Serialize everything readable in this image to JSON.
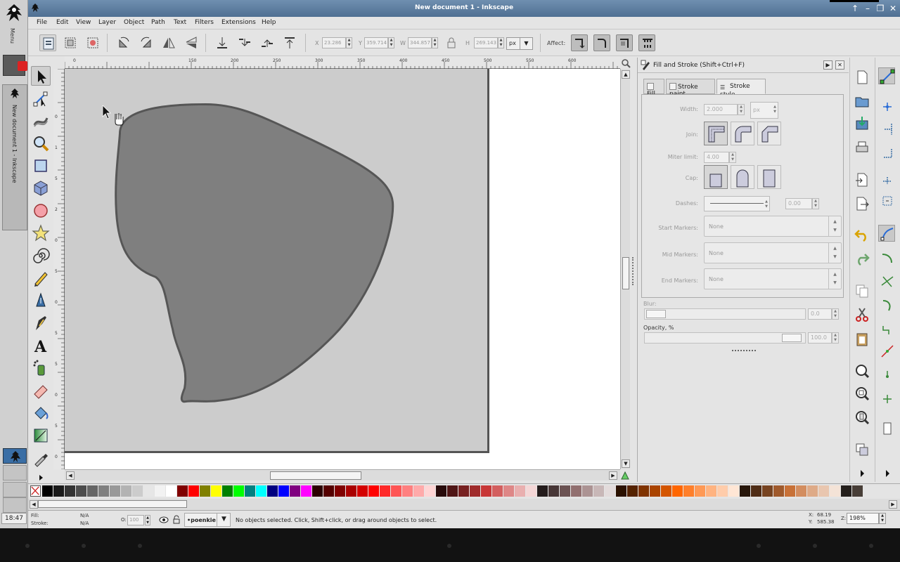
{
  "window": {
    "title": "New document 1 - Inkscape",
    "buttons": [
      "↑",
      "–",
      "❐",
      "✕"
    ]
  },
  "launcher": {
    "menu_label": "Menu",
    "doc_label": "New document 1 - Inkscape",
    "clock": "18:47"
  },
  "menubar": {
    "items": [
      "File",
      "Edit",
      "View",
      "Layer",
      "Object",
      "Path",
      "Text",
      "Filters",
      "Extensions",
      "Help"
    ]
  },
  "toolctrl": {
    "x_label": "X",
    "x_value": "23.286",
    "y_label": "Y",
    "y_value": "359.714",
    "w_label": "W",
    "w_value": "344.857",
    "h_label": "H",
    "h_value": "269.143",
    "unit": "px",
    "affect_label": "Affect:"
  },
  "rulers": {
    "top": [
      "0",
      "150",
      "200",
      "250",
      "300",
      "350",
      "400",
      "450",
      "500",
      "550",
      "600"
    ],
    "left": [
      "0",
      "1",
      "5",
      "2",
      "0",
      "5",
      "0",
      "5",
      "5",
      "0",
      "5",
      "0"
    ]
  },
  "dock": {
    "title": "Fill and Stroke (Shift+Ctrl+F)",
    "tabs": [
      "Fill",
      "Stroke paint",
      "Stroke style"
    ],
    "width_label": "Width:",
    "width_value": "2.000",
    "width_unit": "px",
    "join_label": "Join:",
    "miter_label": "Miter limit:",
    "miter_value": "4.00",
    "cap_label": "Cap:",
    "dashes_label": "Dashes:",
    "dashes_value": "0.00",
    "start_markers_label": "Start Markers:",
    "start_markers_value": "None",
    "mid_markers_label": "Mid Markers:",
    "mid_markers_value": "None",
    "end_markers_label": "End Markers:",
    "end_markers_value": "None",
    "blur_label": "Blur:",
    "blur_value": "0.0",
    "opacity_label": "Opacity, %",
    "opacity_value": "100.0"
  },
  "statusbar": {
    "fill_label": "Fill:",
    "fill_value": "N/A",
    "stroke_label": "Stroke:",
    "stroke_value": "N/A",
    "o_label": "O:",
    "o_value": "100",
    "layer": "•poenkie",
    "message": "No objects selected. Click, Shift+click, or drag around objects to select.",
    "x_label": "X:",
    "x_value": "68.19",
    "y_label": "Y:",
    "y_value": "585.38",
    "z_label": "Z:",
    "zoom": "198%"
  },
  "colors": {
    "shape_fill": "#7f7f7f",
    "page_bg": "#cccccc",
    "titlebar": "#5b7ea3"
  },
  "palette": [
    "#000000",
    "#1a1a1a",
    "#333333",
    "#4d4d4d",
    "#666666",
    "#808080",
    "#999999",
    "#b3b3b3",
    "#cccccc",
    "#e6e6e6",
    "#f2f2f2",
    "#ffffff",
    "#800000",
    "#ff0000",
    "#808000",
    "#ffff00",
    "#008000",
    "#00ff00",
    "#008080",
    "#00ffff",
    "#000080",
    "#0000ff",
    "#800080",
    "#ff00ff",
    "#2b0000",
    "#550000",
    "#800000",
    "#aa0000",
    "#d40000",
    "#ff0000",
    "#ff2a2a",
    "#ff5555",
    "#ff8080",
    "#ffaaaa",
    "#ffd5d5",
    "#280b0b",
    "#501616",
    "#782121",
    "#a02c2c",
    "#c83737",
    "#d35f5f",
    "#de8787",
    "#e9afaf",
    "#f4d7d7",
    "#241c1c",
    "#483737",
    "#6c5353",
    "#916f6f",
    "#ac9393",
    "#c8b7b7",
    "#e3dbdb",
    "#2b1100",
    "#552200",
    "#803300",
    "#aa4400",
    "#d45500",
    "#ff6600",
    "#ff7f2a",
    "#ff9955",
    "#ffb380",
    "#ffccaa",
    "#ffe6d5",
    "#28170b",
    "#502d16",
    "#784421",
    "#a05a2c",
    "#c87137",
    "#d38d5f",
    "#deaa87",
    "#e9c6af",
    "#f4e3d7",
    "#241f1c",
    "#483e37"
  ]
}
